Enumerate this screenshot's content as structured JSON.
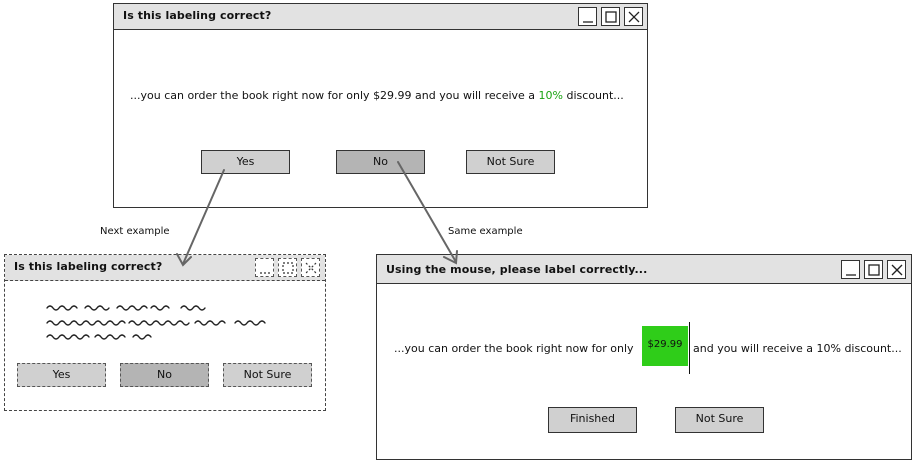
{
  "top_dialog": {
    "title": "Is this labeling correct?",
    "message": {
      "pre": "...you can order the book right now for only $29.99 and you will receive a ",
      "highlight": "10%",
      "post": " discount..."
    },
    "buttons": {
      "yes": "Yes",
      "no": "No",
      "not_sure": "Not Sure"
    }
  },
  "next_dialog": {
    "title": "Is this labeling correct?",
    "buttons": {
      "yes": "Yes",
      "no": "No",
      "not_sure": "Not Sure"
    }
  },
  "label_dialog": {
    "title": "Using the mouse, please label correctly...",
    "message": {
      "pre": "...you can order the book right now for only",
      "highlight": "$29.99",
      "post": "and you will receive a  10% discount..."
    },
    "buttons": {
      "finished": "Finished",
      "not_sure": "Not Sure"
    }
  },
  "flow_labels": {
    "next_example": "Next example",
    "same_example": "Same example"
  },
  "colors": {
    "highlight_green": "#2fcd19",
    "text_green": "#19a312",
    "titlebar": "#e2e2e2"
  }
}
